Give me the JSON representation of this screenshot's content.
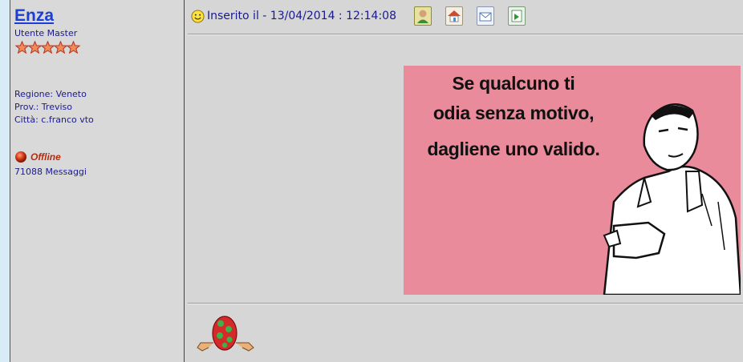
{
  "author": {
    "name": "Enza",
    "rank": "Utente Master",
    "star_count": 5,
    "region": "Regione: Veneto",
    "province": "Prov.: Treviso",
    "city": "Città: c.franco vto",
    "status": "Offline",
    "message_count": "71088 Messaggi"
  },
  "post": {
    "date_line": "Inserito il - 13/04/2014 : 12:14:08",
    "actions": [
      "profile-icon",
      "home-icon",
      "email-icon",
      "quote-icon"
    ],
    "image": {
      "lines": [
        "Se qualcuno ti",
        "odia senza motivo,",
        "dagliene uno valido."
      ]
    }
  },
  "colors": {
    "link": "#1a3fd6",
    "text": "#1a1a8c",
    "offline": "#b42b10",
    "meme_bg": "#e98b9b"
  }
}
